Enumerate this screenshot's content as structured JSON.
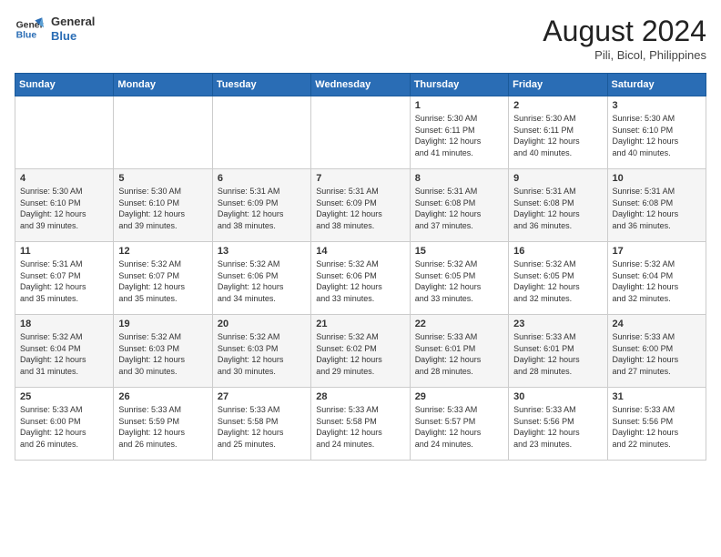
{
  "header": {
    "logo_line1": "General",
    "logo_line2": "Blue",
    "month_year": "August 2024",
    "location": "Pili, Bicol, Philippines"
  },
  "days_of_week": [
    "Sunday",
    "Monday",
    "Tuesday",
    "Wednesday",
    "Thursday",
    "Friday",
    "Saturday"
  ],
  "weeks": [
    [
      {
        "day": "",
        "info": ""
      },
      {
        "day": "",
        "info": ""
      },
      {
        "day": "",
        "info": ""
      },
      {
        "day": "",
        "info": ""
      },
      {
        "day": "1",
        "info": "Sunrise: 5:30 AM\nSunset: 6:11 PM\nDaylight: 12 hours\nand 41 minutes."
      },
      {
        "day": "2",
        "info": "Sunrise: 5:30 AM\nSunset: 6:11 PM\nDaylight: 12 hours\nand 40 minutes."
      },
      {
        "day": "3",
        "info": "Sunrise: 5:30 AM\nSunset: 6:10 PM\nDaylight: 12 hours\nand 40 minutes."
      }
    ],
    [
      {
        "day": "4",
        "info": "Sunrise: 5:30 AM\nSunset: 6:10 PM\nDaylight: 12 hours\nand 39 minutes."
      },
      {
        "day": "5",
        "info": "Sunrise: 5:30 AM\nSunset: 6:10 PM\nDaylight: 12 hours\nand 39 minutes."
      },
      {
        "day": "6",
        "info": "Sunrise: 5:31 AM\nSunset: 6:09 PM\nDaylight: 12 hours\nand 38 minutes."
      },
      {
        "day": "7",
        "info": "Sunrise: 5:31 AM\nSunset: 6:09 PM\nDaylight: 12 hours\nand 38 minutes."
      },
      {
        "day": "8",
        "info": "Sunrise: 5:31 AM\nSunset: 6:08 PM\nDaylight: 12 hours\nand 37 minutes."
      },
      {
        "day": "9",
        "info": "Sunrise: 5:31 AM\nSunset: 6:08 PM\nDaylight: 12 hours\nand 36 minutes."
      },
      {
        "day": "10",
        "info": "Sunrise: 5:31 AM\nSunset: 6:08 PM\nDaylight: 12 hours\nand 36 minutes."
      }
    ],
    [
      {
        "day": "11",
        "info": "Sunrise: 5:31 AM\nSunset: 6:07 PM\nDaylight: 12 hours\nand 35 minutes."
      },
      {
        "day": "12",
        "info": "Sunrise: 5:32 AM\nSunset: 6:07 PM\nDaylight: 12 hours\nand 35 minutes."
      },
      {
        "day": "13",
        "info": "Sunrise: 5:32 AM\nSunset: 6:06 PM\nDaylight: 12 hours\nand 34 minutes."
      },
      {
        "day": "14",
        "info": "Sunrise: 5:32 AM\nSunset: 6:06 PM\nDaylight: 12 hours\nand 33 minutes."
      },
      {
        "day": "15",
        "info": "Sunrise: 5:32 AM\nSunset: 6:05 PM\nDaylight: 12 hours\nand 33 minutes."
      },
      {
        "day": "16",
        "info": "Sunrise: 5:32 AM\nSunset: 6:05 PM\nDaylight: 12 hours\nand 32 minutes."
      },
      {
        "day": "17",
        "info": "Sunrise: 5:32 AM\nSunset: 6:04 PM\nDaylight: 12 hours\nand 32 minutes."
      }
    ],
    [
      {
        "day": "18",
        "info": "Sunrise: 5:32 AM\nSunset: 6:04 PM\nDaylight: 12 hours\nand 31 minutes."
      },
      {
        "day": "19",
        "info": "Sunrise: 5:32 AM\nSunset: 6:03 PM\nDaylight: 12 hours\nand 30 minutes."
      },
      {
        "day": "20",
        "info": "Sunrise: 5:32 AM\nSunset: 6:03 PM\nDaylight: 12 hours\nand 30 minutes."
      },
      {
        "day": "21",
        "info": "Sunrise: 5:32 AM\nSunset: 6:02 PM\nDaylight: 12 hours\nand 29 minutes."
      },
      {
        "day": "22",
        "info": "Sunrise: 5:33 AM\nSunset: 6:01 PM\nDaylight: 12 hours\nand 28 minutes."
      },
      {
        "day": "23",
        "info": "Sunrise: 5:33 AM\nSunset: 6:01 PM\nDaylight: 12 hours\nand 28 minutes."
      },
      {
        "day": "24",
        "info": "Sunrise: 5:33 AM\nSunset: 6:00 PM\nDaylight: 12 hours\nand 27 minutes."
      }
    ],
    [
      {
        "day": "25",
        "info": "Sunrise: 5:33 AM\nSunset: 6:00 PM\nDaylight: 12 hours\nand 26 minutes."
      },
      {
        "day": "26",
        "info": "Sunrise: 5:33 AM\nSunset: 5:59 PM\nDaylight: 12 hours\nand 26 minutes."
      },
      {
        "day": "27",
        "info": "Sunrise: 5:33 AM\nSunset: 5:58 PM\nDaylight: 12 hours\nand 25 minutes."
      },
      {
        "day": "28",
        "info": "Sunrise: 5:33 AM\nSunset: 5:58 PM\nDaylight: 12 hours\nand 24 minutes."
      },
      {
        "day": "29",
        "info": "Sunrise: 5:33 AM\nSunset: 5:57 PM\nDaylight: 12 hours\nand 24 minutes."
      },
      {
        "day": "30",
        "info": "Sunrise: 5:33 AM\nSunset: 5:56 PM\nDaylight: 12 hours\nand 23 minutes."
      },
      {
        "day": "31",
        "info": "Sunrise: 5:33 AM\nSunset: 5:56 PM\nDaylight: 12 hours\nand 22 minutes."
      }
    ]
  ]
}
